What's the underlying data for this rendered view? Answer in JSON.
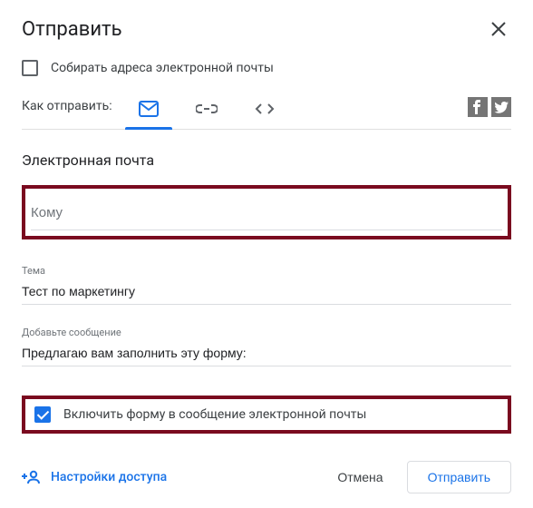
{
  "header": {
    "title": "Отправить"
  },
  "collect": {
    "label": "Собирать адреса электронной почты",
    "checked": false
  },
  "method": {
    "label": "Как отправить:"
  },
  "section": {
    "title": "Электронная почта"
  },
  "fields": {
    "to_placeholder": "Кому",
    "to_value": "",
    "subject_label": "Тема",
    "subject_value": "Тест по маркетингу",
    "message_label": "Добавьте сообщение",
    "message_value": "Предлагаю вам заполнить эту форму:"
  },
  "include": {
    "label": "Включить форму в сообщение электронной почты",
    "checked": true
  },
  "footer": {
    "sharing": "Настройки доступа",
    "cancel": "Отмена",
    "send": "Отправить"
  }
}
